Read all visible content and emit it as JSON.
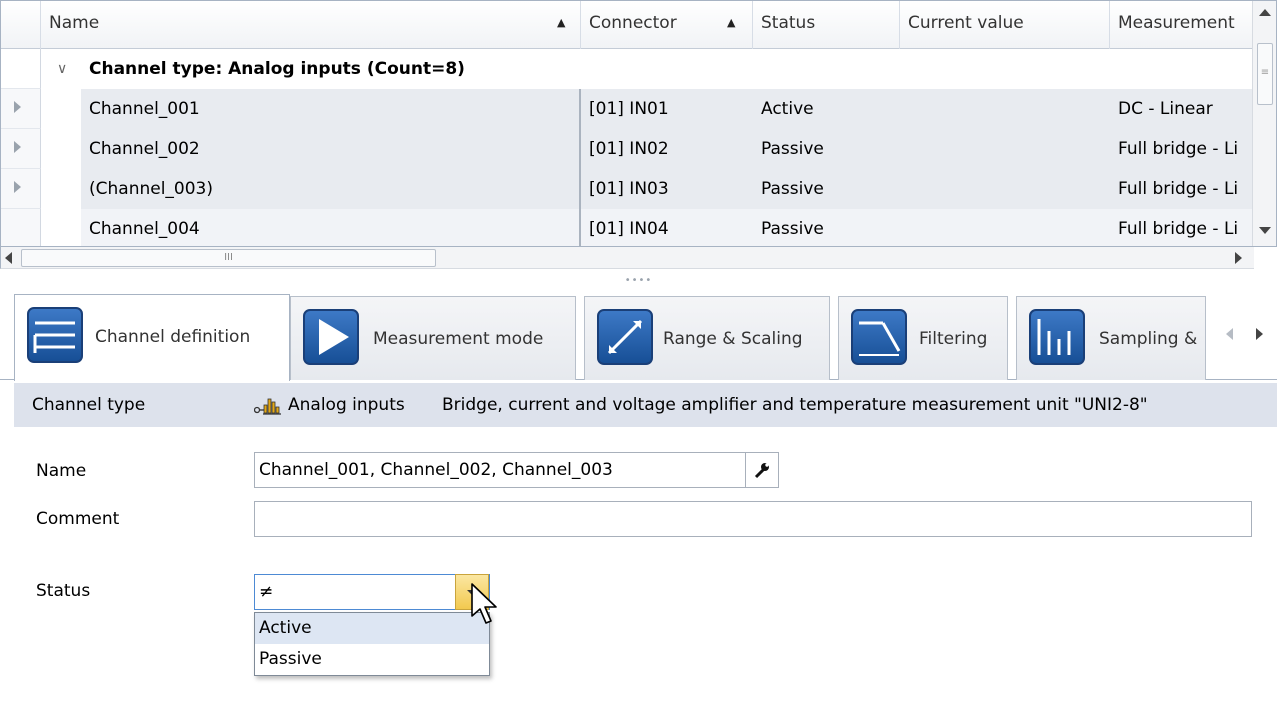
{
  "grid": {
    "columns": [
      {
        "label": "Name",
        "sort": "asc"
      },
      {
        "label": "Connector",
        "sort": "asc"
      },
      {
        "label": "Status"
      },
      {
        "label": "Current value"
      },
      {
        "label": "Measurement"
      }
    ],
    "group_label": "Channel type: Analog inputs (Count=8)",
    "rows": [
      {
        "name": "Channel_001",
        "connector": "[01] IN01",
        "status": "Active",
        "current_value": "",
        "measurement": "DC - Linear"
      },
      {
        "name": "Channel_002",
        "connector": "[01] IN02",
        "status": "Passive",
        "current_value": "",
        "measurement": "Full bridge - Li"
      },
      {
        "name": "(Channel_003)",
        "connector": "[01] IN03",
        "status": "Passive",
        "current_value": "",
        "measurement": "Full bridge - Li"
      },
      {
        "name": "Channel_004",
        "connector": "[01] IN04",
        "status": "Passive",
        "current_value": "",
        "measurement": "Full bridge - Li"
      }
    ]
  },
  "tabs": [
    {
      "label": "Channel definition",
      "icon": "channel-definition-icon",
      "active": true
    },
    {
      "label": "Measurement mode",
      "icon": "measurement-mode-icon"
    },
    {
      "label": "Range & Scaling",
      "icon": "range-scaling-icon"
    },
    {
      "label": "Filtering",
      "icon": "filtering-icon"
    },
    {
      "label": "Sampling &",
      "icon": "sampling-icon"
    }
  ],
  "info": {
    "label": "Channel type",
    "type_icon": "analog-inputs-icon",
    "type_value": "Analog inputs",
    "description": "Bridge, current and voltage amplifier and temperature measurement unit \"UNI2-8\""
  },
  "form": {
    "name_label": "Name",
    "name_value": "Channel_001, Channel_002, Channel_003",
    "comment_label": "Comment",
    "comment_value": "",
    "status_label": "Status",
    "status_value": "≠",
    "status_options": [
      "Active",
      "Passive"
    ]
  },
  "colors": {
    "accent": "#2a63ad",
    "dropdown_button": "#f2c94f",
    "selected_row": "#e8ebf0",
    "info_bar": "#dde2ec"
  }
}
